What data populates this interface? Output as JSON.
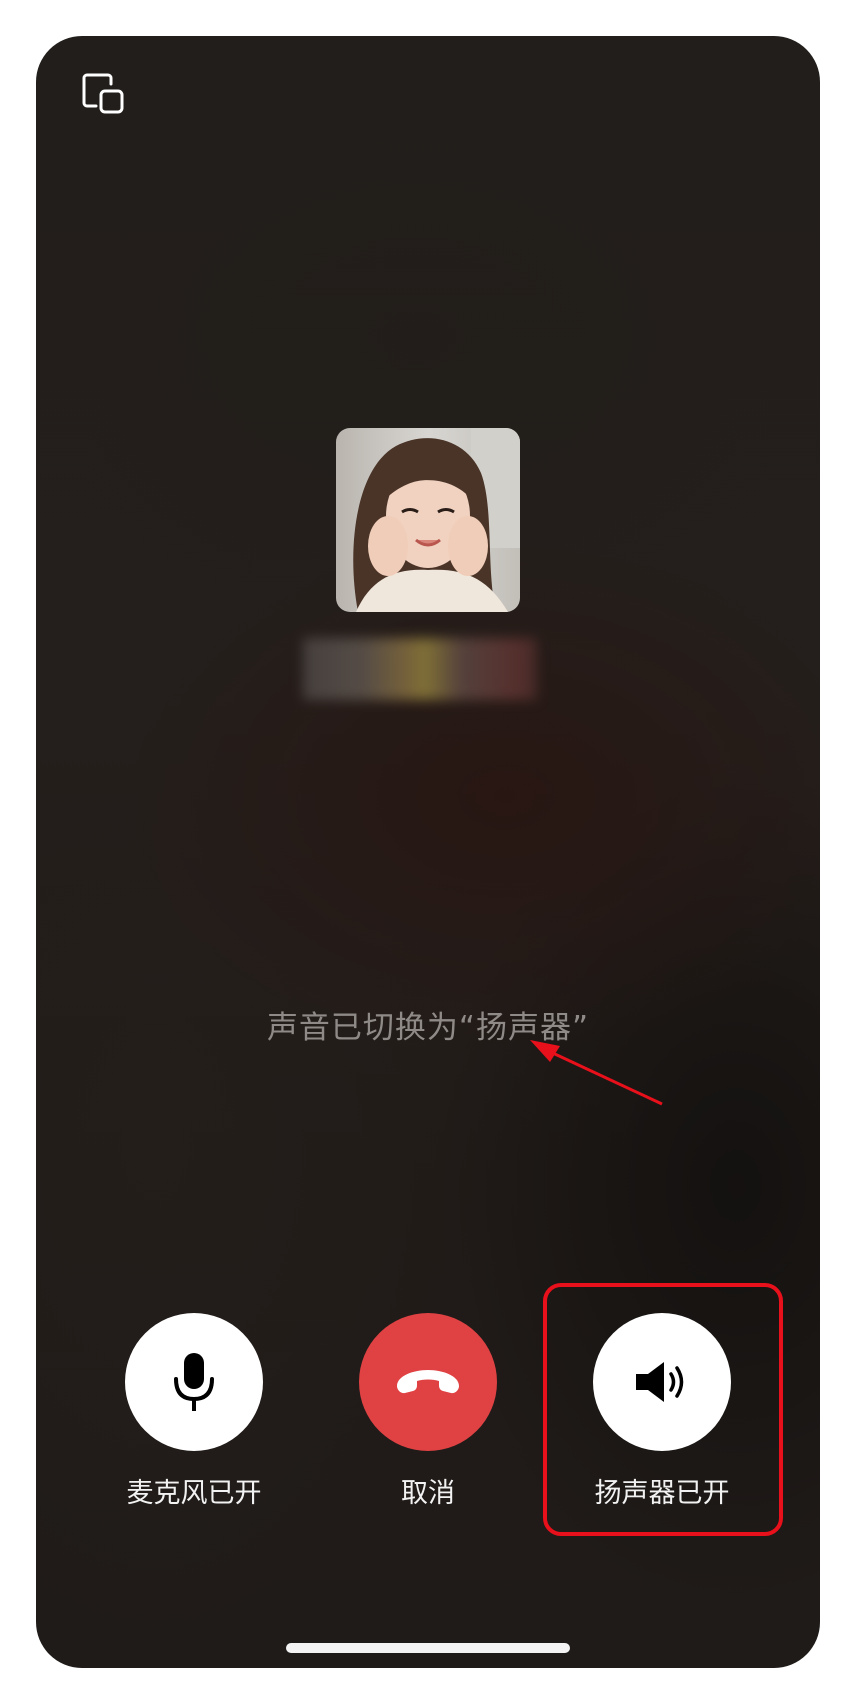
{
  "call": {
    "status_message": "声音已切换为“扬声器”",
    "caller_name_obscured": true
  },
  "controls": [
    {
      "id": "microphone",
      "label": "麦克风已开",
      "icon": "microphone-icon",
      "state": "on"
    },
    {
      "id": "cancel",
      "label": "取消",
      "icon": "hang-up-icon",
      "state": "active"
    },
    {
      "id": "speaker",
      "label": "扬声器已开",
      "icon": "speaker-icon",
      "state": "on"
    }
  ],
  "top_bar": {
    "icon": "picture-in-picture-icon"
  },
  "colors": {
    "background": "#231e1b",
    "hang_up": "#e04244",
    "control_bg": "#ffffff",
    "label_text": "#f2f2f2",
    "status_text": "#8f8a87",
    "annotation": "#e8101a"
  }
}
